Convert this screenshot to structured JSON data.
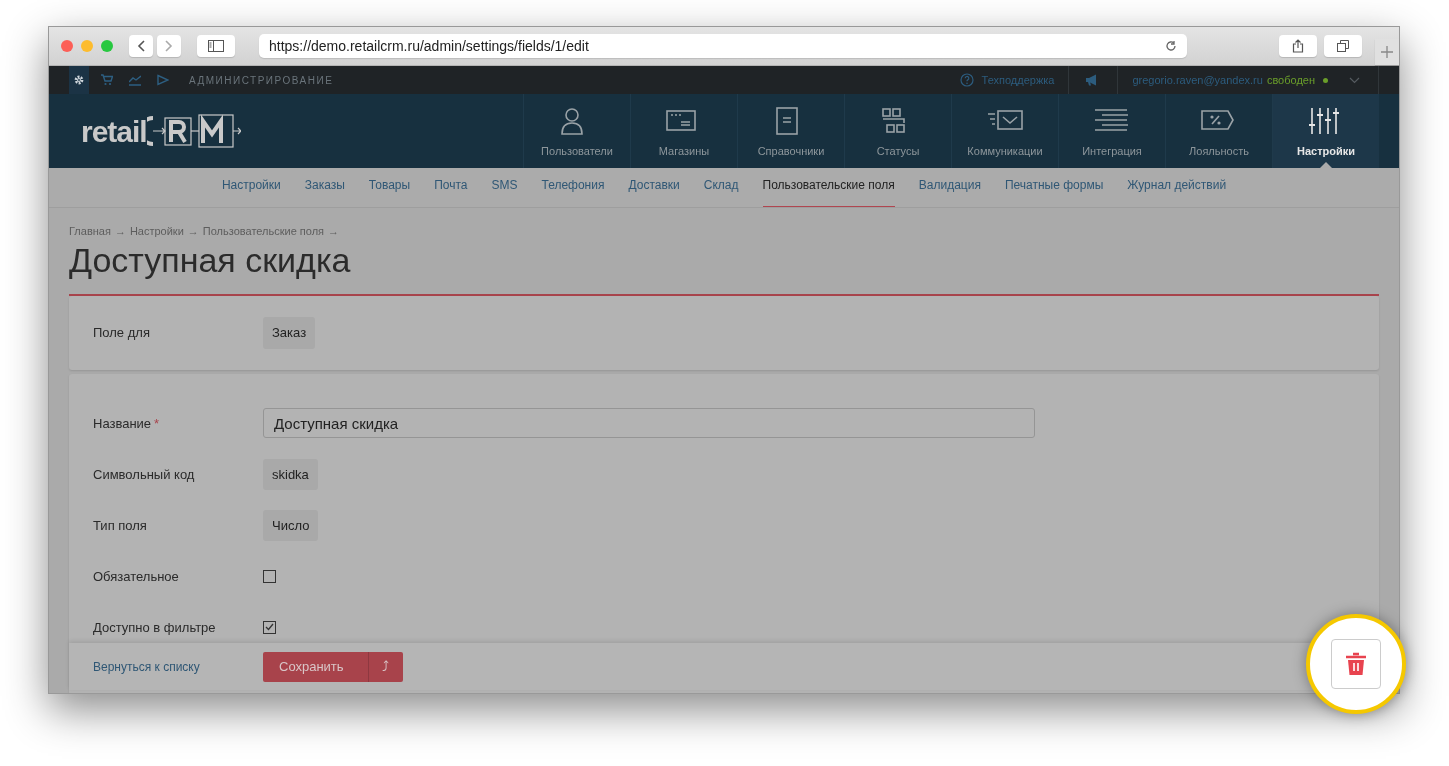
{
  "browser": {
    "url": "https://demo.retailcrm.ru/admin/settings/fields/1/edit"
  },
  "topbar": {
    "apps": [
      {
        "kind": "gear",
        "selected": true
      },
      {
        "kind": "cart",
        "selected": false
      },
      {
        "kind": "chart",
        "selected": false
      },
      {
        "kind": "play",
        "selected": false
      }
    ],
    "section": "АДМИНИСТРИРОВАНИЕ",
    "support": "Техподдержка",
    "user": "gregorio.raven@yandex.ru",
    "status": "свободен"
  },
  "logo": {
    "text": "retail"
  },
  "main_nav": [
    {
      "kind": "users",
      "label": "Пользователи",
      "selected": false
    },
    {
      "kind": "shops",
      "label": "Магазины",
      "selected": false
    },
    {
      "kind": "dictionaries",
      "label": "Справочники",
      "selected": false
    },
    {
      "kind": "statuses",
      "label": "Статусы",
      "selected": false
    },
    {
      "kind": "communications",
      "label": "Коммуникации",
      "selected": false
    },
    {
      "kind": "integration",
      "label": "Интеграция",
      "selected": false
    },
    {
      "kind": "loyalty",
      "label": "Лояльность",
      "selected": false
    },
    {
      "kind": "settings",
      "label": "Настройки",
      "selected": true
    }
  ],
  "sub_nav": [
    {
      "label": "Настройки",
      "selected": false
    },
    {
      "label": "Заказы",
      "selected": false
    },
    {
      "label": "Товары",
      "selected": false
    },
    {
      "label": "Почта",
      "selected": false
    },
    {
      "label": "SMS",
      "selected": false
    },
    {
      "label": "Телефония",
      "selected": false
    },
    {
      "label": "Доставки",
      "selected": false
    },
    {
      "label": "Склад",
      "selected": false
    },
    {
      "label": "Пользовательские поля",
      "selected": true
    },
    {
      "label": "Валидация",
      "selected": false
    },
    {
      "label": "Печатные формы",
      "selected": false
    },
    {
      "label": "Журнал действий",
      "selected": false
    }
  ],
  "breadcrumbs": {
    "items": [
      "Главная",
      "Настройки",
      "Пользовательские поля"
    ],
    "separator": "→"
  },
  "title": "Доступная скидка",
  "field_for": {
    "label": "Поле для",
    "value": "Заказ"
  },
  "fields": [
    {
      "kind": "input",
      "label": "Название",
      "required_mark": "*",
      "value": "Доступная скидка"
    },
    {
      "kind": "tag",
      "label": "Символьный код",
      "value": "skidka"
    },
    {
      "kind": "tag",
      "label": "Тип поля",
      "value": "Число"
    },
    {
      "kind": "checkbox",
      "label": "Обязательное",
      "checked": false
    },
    {
      "kind": "checkbox",
      "label": "Доступно в фильтре",
      "checked": true
    }
  ],
  "footer": {
    "back_link": "Вернуться к списку",
    "save_button": "Сохранить",
    "save_menu": "⤴"
  }
}
